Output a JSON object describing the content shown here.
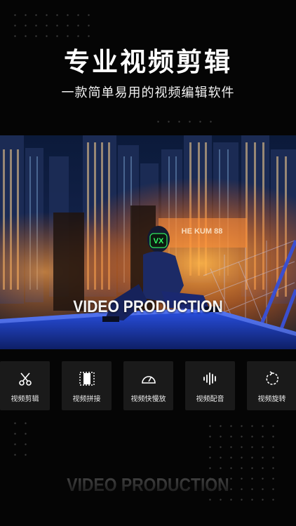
{
  "header": {
    "title": "专业视频剪辑",
    "subtitle": "一款简单易用的视频编辑软件"
  },
  "hero": {
    "caption": "VIDEO PRODUCTION",
    "mask_text": "VX",
    "sign_text": "HE KUM 88"
  },
  "tools": [
    {
      "label": "视频剪辑",
      "icon": "scissors-icon"
    },
    {
      "label": "视频拼接",
      "icon": "film-frame-icon"
    },
    {
      "label": "视频快慢放",
      "icon": "speedometer-icon"
    },
    {
      "label": "视频配音",
      "icon": "audio-wave-icon"
    },
    {
      "label": "视频旋转",
      "icon": "rotate-icon"
    }
  ],
  "footer": {
    "watermark": "VIDEO PRODUCTION"
  },
  "colors": {
    "background": "#050505",
    "tile": "#1a1a1a",
    "mask_glow": "#33ff66",
    "city_orange": "#ff8a2a",
    "sky_blue": "#1d4fd8"
  }
}
